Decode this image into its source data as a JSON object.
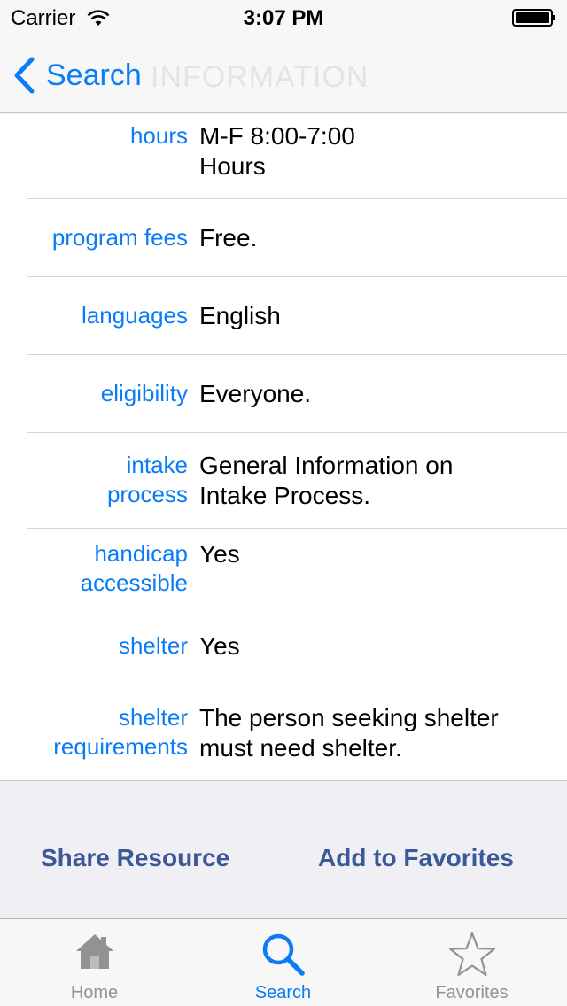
{
  "status_bar": {
    "carrier": "Carrier",
    "time": "3:07 PM"
  },
  "nav": {
    "back_label": "Search",
    "title": "INFORMATION"
  },
  "rows": [
    {
      "label": "hours",
      "value": "M-F 8:00-7:00\nHours"
    },
    {
      "label": "program fees",
      "value": "Free."
    },
    {
      "label": "languages",
      "value": "English"
    },
    {
      "label": "eligibility",
      "value": "Everyone."
    },
    {
      "label": "intake\nprocess",
      "value": "General Information on\nIntake Process."
    },
    {
      "label": "handicap\naccessible",
      "value": "Yes"
    },
    {
      "label": "shelter",
      "value": "Yes"
    },
    {
      "label": "shelter\nrequirements",
      "value": "The person seeking shelter\nmust need shelter."
    }
  ],
  "actions": {
    "share_label": "Share Resource",
    "favorites_label": "Add to Favorites"
  },
  "tabs": [
    {
      "label": "Home",
      "icon": "house-icon",
      "active": false
    },
    {
      "label": "Search",
      "icon": "magnifier-icon",
      "active": true
    },
    {
      "label": "Favorites",
      "icon": "star-icon",
      "active": false
    }
  ],
  "colors": {
    "accent": "#0a7cf5",
    "action_text": "#3b5998",
    "inactive_tab": "#929292"
  }
}
